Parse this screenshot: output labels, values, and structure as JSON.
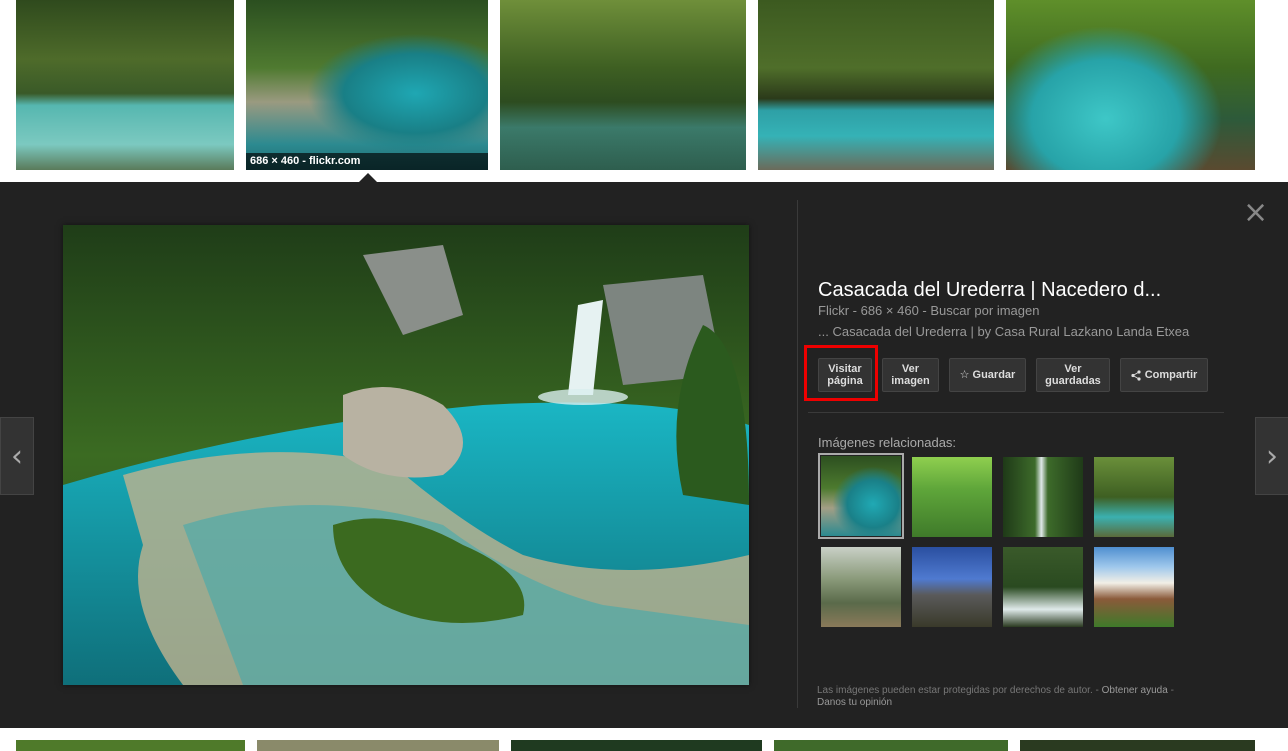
{
  "top_strip": {
    "selected_caption": "686 × 460 - flickr.com"
  },
  "viewer": {
    "title": "Casacada del Urederra | Nacedero d...",
    "meta": "Flickr - 686 × 460 - Buscar por imagen",
    "description": "... Casacada del Urederra | by Casa Rural Lazkano Landa Etxea",
    "buttons": {
      "visit_line1": "Visitar",
      "visit_line2": "página",
      "view_line1": "Ver",
      "view_line2": "imagen",
      "save": "Guardar",
      "saved_line1": "Ver",
      "saved_line2": "guardadas",
      "share": "Compartir"
    },
    "related_label": "Imágenes relacionadas:",
    "footer": {
      "notice": "Las imágenes pueden estar protegidas por derechos de autor.",
      "sep1": " - ",
      "help": "Obtener ayuda",
      "sep2": " - ",
      "feedback": "Danos tu opinión"
    }
  },
  "colors": {
    "panel_bg": "#222222",
    "highlight": "#e00000",
    "water": "#2bb0b8"
  },
  "icons": {
    "close": "close-icon",
    "prev": "chevron-left-icon",
    "next": "chevron-right-icon",
    "save": "star-icon",
    "share": "share-icon"
  }
}
